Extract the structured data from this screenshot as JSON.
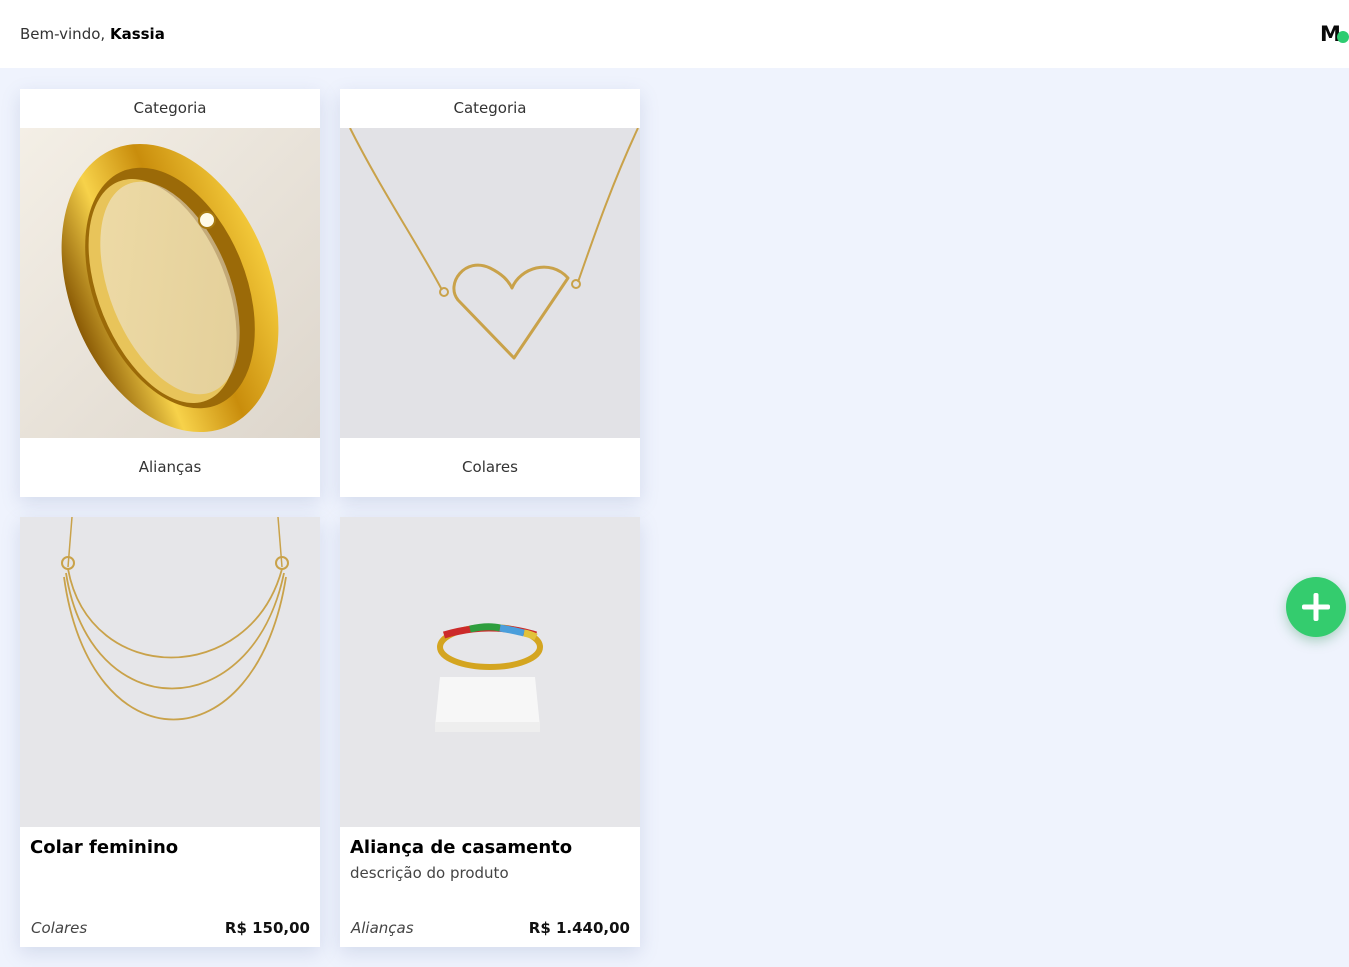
{
  "header": {
    "greeting": "Bem-vindo,",
    "user_name": "Kassia",
    "logo_text": "M",
    "logo_name": "app-logo"
  },
  "categories": [
    {
      "header": "Categoria",
      "name": "Alianças",
      "image": "gold-wedding-ring-photo"
    },
    {
      "header": "Categoria",
      "name": "Colares",
      "image": "heart-necklace-photo"
    }
  ],
  "products": [
    {
      "title": "Colar feminino",
      "description": "",
      "category": "Colares",
      "price": "R$ 150,00",
      "image": "layered-gold-necklace-photo"
    },
    {
      "title": "Aliança de casamento",
      "description": "descrição do produto",
      "category": "Alianças",
      "price": "R$ 1.440,00",
      "image": "rainbow-gem-ring-photo"
    }
  ],
  "fab": {
    "icon": "plus-icon",
    "color": "#34cc6e"
  },
  "colors": {
    "background": "#eff3fd",
    "accent": "#34cc6e",
    "gold": "#d4a520"
  }
}
